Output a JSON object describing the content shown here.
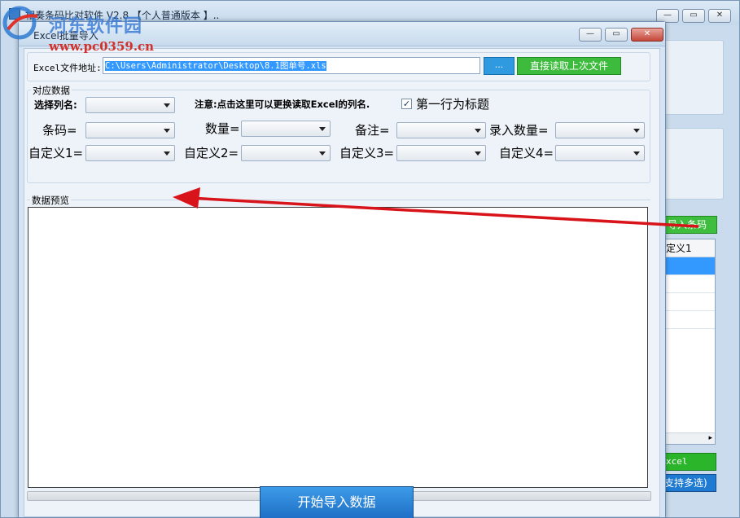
{
  "main_window": {
    "title": "相奏条码比对软件 V2.8 【个人普通版本 】..",
    "side_button_1": "导入条码",
    "side_list_header": "定义1",
    "side_button_2": "xcel",
    "side_button_3": "支持多选)",
    "scroll_glyph": "▸"
  },
  "watermark": {
    "name": "河东软件园",
    "url": "www.pc0359.cn"
  },
  "dialog": {
    "title": "Excel批量导入",
    "minimize_glyph": "—",
    "maximize_glyph": "▭",
    "close_glyph": "✕",
    "file_label": "Excel文件地址:",
    "file_path": "C:\\Users\\Administrator\\Desktop\\8.1图单号.xls",
    "browse_label": "...",
    "read_last_label": "直接读取上次文件",
    "mapping_group_label": "对应数据",
    "select_column_label": "选择列名:",
    "note_text": "注意:点击这里可以更换读取Excel的列名.",
    "first_row_header_label": "第一行为标题",
    "first_row_header_checked": "✓",
    "fields": {
      "barcode": "条码=",
      "quantity": "数量=",
      "remark": "备注=",
      "entered_qty": "录入数量=",
      "custom1": "自定义1=",
      "custom2": "自定义2=",
      "custom3": "自定义3=",
      "custom4": "自定义4="
    },
    "preview_group_label": "数据预览",
    "start_button": "开始导入数据"
  },
  "colors": {
    "accent_green": "#3dbb3d",
    "accent_blue": "#2f9ae0",
    "arrow_red": "#d8141a"
  }
}
